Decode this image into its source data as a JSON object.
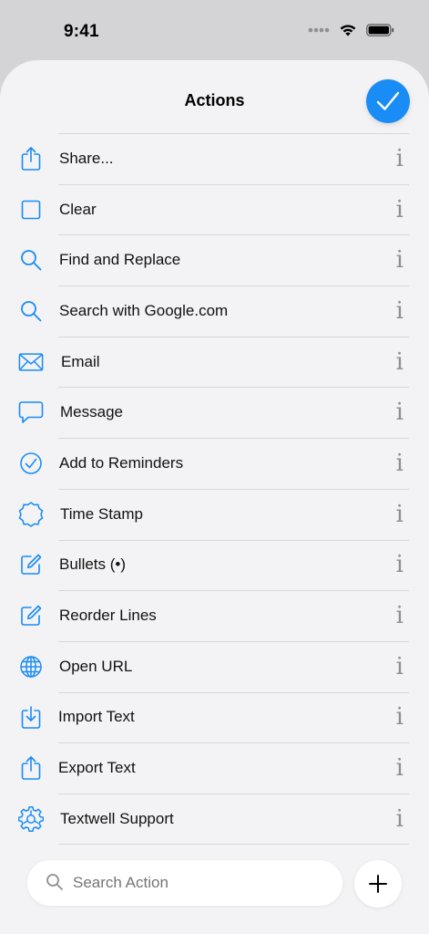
{
  "status_bar": {
    "time": "9:41"
  },
  "sheet": {
    "title": "Actions"
  },
  "actions": [
    {
      "label": "Share...",
      "icon": "share-icon"
    },
    {
      "label": "Clear",
      "icon": "square-icon"
    },
    {
      "label": "Find and Replace",
      "icon": "magnifier-icon"
    },
    {
      "label": "Search with Google.com",
      "icon": "magnifier-icon"
    },
    {
      "label": "Email",
      "icon": "envelope-icon"
    },
    {
      "label": "Message",
      "icon": "speech-bubble-icon"
    },
    {
      "label": "Add to Reminders",
      "icon": "checkmark-circle-icon"
    },
    {
      "label": "Time Stamp",
      "icon": "seal-icon"
    },
    {
      "label": "Bullets (•)",
      "icon": "compose-icon"
    },
    {
      "label": "Reorder Lines",
      "icon": "compose-icon"
    },
    {
      "label": "Open URL",
      "icon": "globe-icon"
    },
    {
      "label": "Import Text",
      "icon": "import-icon"
    },
    {
      "label": "Export Text",
      "icon": "share-icon"
    },
    {
      "label": "Textwell Support",
      "icon": "gear-icon"
    }
  ],
  "info_glyph": "i",
  "search": {
    "placeholder": "Search Action"
  },
  "colors": {
    "accent": "#1a8cf5",
    "background": "#f3f3f5",
    "status_bar": "#d4d4d6"
  }
}
